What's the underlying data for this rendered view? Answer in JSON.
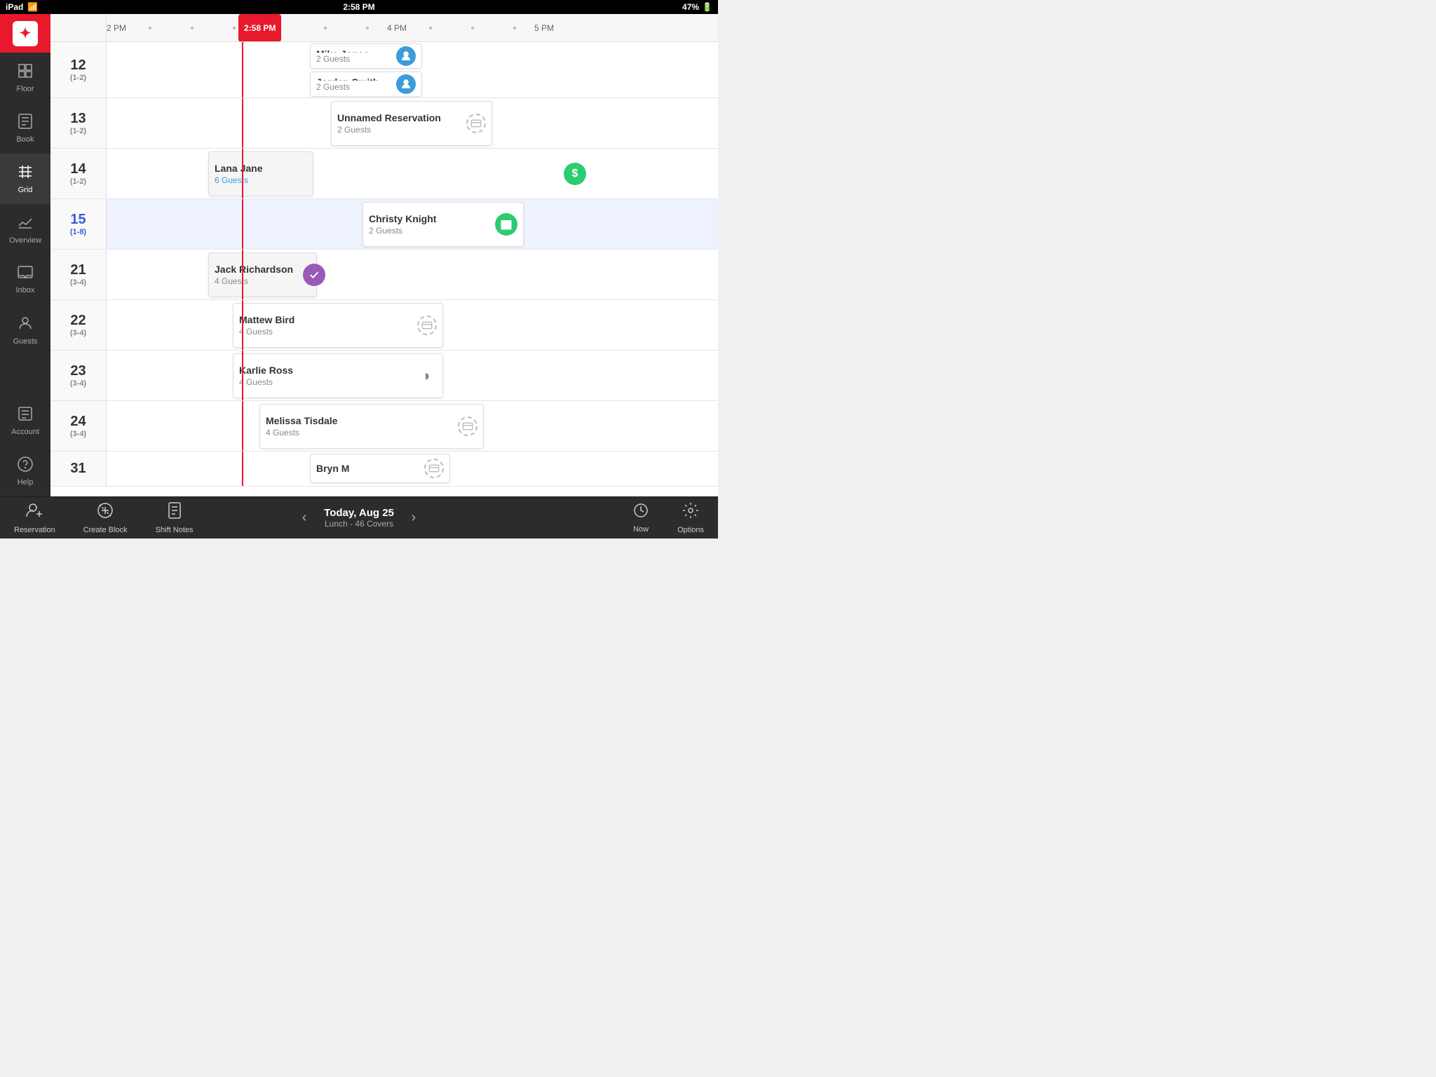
{
  "status_bar": {
    "left": "iPad  ✦",
    "time": "2:58 PM",
    "battery": "47%"
  },
  "sidebar": {
    "logo_text": "✦",
    "items": [
      {
        "id": "floor",
        "label": "Floor",
        "icon": "⊞"
      },
      {
        "id": "book",
        "label": "Book",
        "icon": "📖"
      },
      {
        "id": "grid",
        "label": "Grid",
        "icon": "⊟",
        "active": true
      },
      {
        "id": "overview",
        "label": "Overview",
        "icon": "📊"
      },
      {
        "id": "inbox",
        "label": "Inbox",
        "icon": "💬"
      },
      {
        "id": "guests",
        "label": "Guests",
        "icon": "👤"
      },
      {
        "id": "account",
        "label": "Account",
        "icon": "📋"
      },
      {
        "id": "help",
        "label": "Help",
        "icon": "?"
      }
    ]
  },
  "timeline": {
    "times": [
      "2 PM",
      "2:58 PM",
      "4 PM",
      "5 PM"
    ],
    "current_time": "2:58 PM",
    "rows": [
      {
        "table": "12",
        "capacity": "(1-2)",
        "reservations": [
          {
            "id": "r1",
            "name": "Mike Jones",
            "guests": "2 Guests",
            "icon_type": "blue-user",
            "start_pct": 48,
            "width_pct": 26
          },
          {
            "id": "r2",
            "name": "Jordan Smith",
            "guests": "2 Guests",
            "icon_type": "blue-user",
            "start_pct": 48,
            "width_pct": 26,
            "row_offset": true
          }
        ]
      },
      {
        "table": "13",
        "capacity": "(1-2)",
        "reservations": [
          {
            "id": "r3",
            "name": "Unnamed Reservation",
            "guests": "2 Guests",
            "icon_type": "grey-block",
            "start_pct": 53,
            "width_pct": 38
          }
        ]
      },
      {
        "table": "14",
        "capacity": "(1-2)",
        "reservations": [
          {
            "id": "r4",
            "name": "Lana Jane",
            "guests": "6 Guests",
            "guests_highlight": true,
            "icon_type": "none",
            "start_pct": 24,
            "width_pct": 25
          },
          {
            "id": "r5",
            "name": "",
            "guests": "",
            "icon_type": "green-dollar",
            "start_pct": 53,
            "width_pct": 38,
            "icon_only": true
          }
        ]
      },
      {
        "table": "15",
        "capacity": "(1-8)",
        "active": true,
        "reservations": [
          {
            "id": "r6",
            "name": "Christy Knight",
            "guests": "2 Guests",
            "icon_type": "green-check-cal",
            "start_pct": 60,
            "width_pct": 38
          }
        ]
      },
      {
        "table": "21",
        "capacity": "(3-4)",
        "reservations": [
          {
            "id": "r7",
            "name": "Jack Richardson",
            "guests": "4 Guests",
            "icon_type": "none",
            "start_pct": 24,
            "width_pct": 25
          },
          {
            "id": "r8",
            "name": "",
            "guests": "",
            "icon_type": "purple-check",
            "start_pct": 53,
            "width_pct": 10,
            "icon_only": true
          }
        ]
      },
      {
        "table": "22",
        "capacity": "(3-4)",
        "reservations": [
          {
            "id": "r9",
            "name": "Mattew Bird",
            "guests": "4 Guests",
            "icon_type": "grey-block",
            "start_pct": 30,
            "width_pct": 50
          }
        ]
      },
      {
        "table": "23",
        "capacity": "(3-4)",
        "reservations": [
          {
            "id": "r10",
            "name": "Karlie Ross",
            "guests": "4 Guests",
            "icon_type": "half-moon",
            "start_pct": 30,
            "width_pct": 50
          }
        ]
      },
      {
        "table": "24",
        "capacity": "(3-4)",
        "reservations": [
          {
            "id": "r11",
            "name": "Melissa Tisdale",
            "guests": "4 Guests",
            "icon_type": "grey-block",
            "start_pct": 36,
            "width_pct": 52
          }
        ]
      },
      {
        "table": "31",
        "capacity": "",
        "reservations": [
          {
            "id": "r12",
            "name": "Bryn M",
            "guests": "",
            "icon_type": "grey-block",
            "start_pct": 48,
            "width_pct": 38
          }
        ]
      }
    ]
  },
  "bottom_toolbar": {
    "buttons": [
      {
        "id": "reservation",
        "label": "Reservation",
        "icon": "👤+"
      },
      {
        "id": "create-block",
        "label": "Create Block",
        "icon": "⊘+"
      },
      {
        "id": "shift-notes",
        "label": "Shift Notes",
        "icon": "📋"
      }
    ],
    "nav": {
      "prev_icon": "‹",
      "next_icon": "›",
      "date": "Today, Aug 25",
      "subtitle": "Lunch - 46 Covers",
      "now_label": "Now",
      "options_label": "Options"
    }
  }
}
